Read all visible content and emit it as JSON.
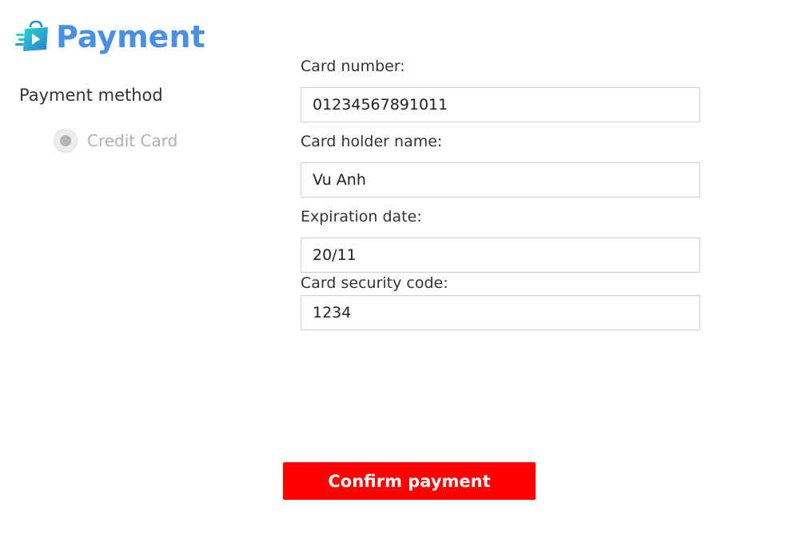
{
  "header": {
    "title": "Payment",
    "logo_icon": "shopping-bag-delivery-icon",
    "title_color": "#4a90e2"
  },
  "payment_method": {
    "label": "Payment method",
    "options": [
      {
        "label": "Credit Card",
        "selected": true,
        "disabled": true
      }
    ]
  },
  "form": {
    "card_number": {
      "label": "Card number:",
      "value": "01234567891011"
    },
    "card_holder": {
      "label": "Card holder name:",
      "value": "Vu Anh"
    },
    "expiration": {
      "label": "Expiration date:",
      "value": "20/11"
    },
    "security_code": {
      "label": "Card security code:",
      "value": "1234"
    }
  },
  "actions": {
    "confirm_label": "Confirm payment",
    "confirm_color": "#ff0000"
  }
}
